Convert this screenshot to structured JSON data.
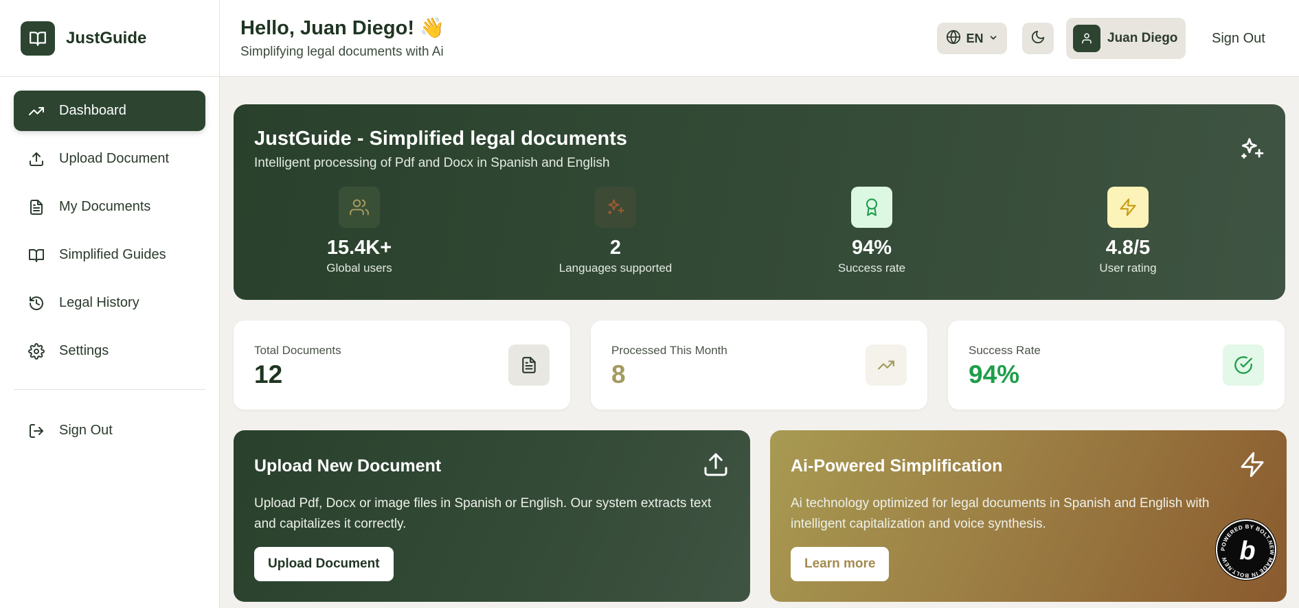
{
  "brand": {
    "name": "JustGuide"
  },
  "sidebar": {
    "items": [
      {
        "label": "Dashboard",
        "icon": "trending-up-icon",
        "active": true
      },
      {
        "label": "Upload Document",
        "icon": "upload-icon"
      },
      {
        "label": "My Documents",
        "icon": "file-text-icon"
      },
      {
        "label": "Simplified Guides",
        "icon": "book-open-icon"
      },
      {
        "label": "Legal History",
        "icon": "history-icon"
      },
      {
        "label": "Settings",
        "icon": "gear-icon"
      }
    ],
    "signout": {
      "label": "Sign Out",
      "icon": "sign-out-icon"
    }
  },
  "header": {
    "greeting": "Hello, Juan Diego! 👋",
    "subtitle": "Simplifying legal documents with Ai",
    "language": "EN",
    "user_name": "Juan Diego",
    "signout": "Sign Out"
  },
  "hero": {
    "title": "JustGuide - Simplified legal documents",
    "subtitle": "Intelligent processing of Pdf and Docx in Spanish and English",
    "stats": [
      {
        "value": "15.4K+",
        "label": "Global users",
        "icon": "users-icon"
      },
      {
        "value": "2",
        "label": "Languages supported",
        "icon": "sparkles-icon"
      },
      {
        "value": "94%",
        "label": "Success rate",
        "icon": "award-icon"
      },
      {
        "value": "4.8/5",
        "label": "User rating",
        "icon": "bolt-icon"
      }
    ]
  },
  "metrics": [
    {
      "label": "Total Documents",
      "value": "12",
      "color": "#1f3522",
      "icon": "file-text-icon"
    },
    {
      "label": "Processed This Month",
      "value": "8",
      "color": "#a39a5f",
      "icon": "trending-up-icon"
    },
    {
      "label": "Success Rate",
      "value": "94%",
      "color": "#1e9e4a",
      "icon": "check-circle-icon"
    }
  ],
  "actions": {
    "upload": {
      "title": "Upload New Document",
      "description": "Upload Pdf, Docx or image files in Spanish or English. Our system extracts text and capitalizes it correctly.",
      "button": "Upload Document"
    },
    "ai": {
      "title": "Ai-Powered Simplification",
      "description": "Ai technology optimized for legal documents in Spanish and English with intelligent capitalization and voice synthesis.",
      "button": "Learn more"
    }
  },
  "badge": {
    "text": "POWERED BY BOLT.NEW MADE IN BOLT.NEW",
    "letter": "b"
  },
  "colors": {
    "primary": "#2c4430",
    "accent_gold": "#a39a5f",
    "success": "#1e9e4a",
    "background": "#f3f1ed"
  }
}
